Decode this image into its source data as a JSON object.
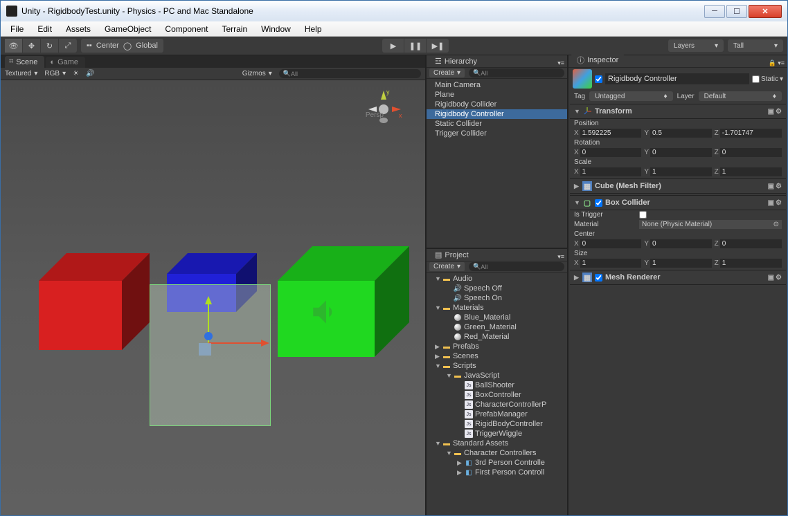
{
  "window": {
    "title": "Unity - RigidbodyTest.unity - Physics - PC and Mac Standalone"
  },
  "menu": [
    "File",
    "Edit",
    "Assets",
    "GameObject",
    "Component",
    "Terrain",
    "Window",
    "Help"
  ],
  "toolbar": {
    "center": "Center",
    "global": "Global",
    "layers": "Layers",
    "layout": "Tall"
  },
  "sceneTab": "Scene",
  "gameTab": "Game",
  "sceneBar": {
    "render": "Textured",
    "color": "RGB",
    "gizmos": "Gizmos",
    "search": "All"
  },
  "persp": "Persp",
  "hierarchy": {
    "title": "Hierarchy",
    "create": "Create",
    "search": "All",
    "items": [
      "Main Camera",
      "Plane",
      "Rigidbody Collider",
      "Rigidbody Controller",
      "Static Collider",
      "Trigger Collider"
    ]
  },
  "project": {
    "title": "Project",
    "create": "Create",
    "search": "All",
    "tree": [
      {
        "n": "Audio",
        "t": "folder",
        "d": 0,
        "open": true
      },
      {
        "n": "Speech Off",
        "t": "audio",
        "d": 1
      },
      {
        "n": "Speech On",
        "t": "audio",
        "d": 1
      },
      {
        "n": "Materials",
        "t": "folder",
        "d": 0,
        "open": true
      },
      {
        "n": "Blue_Material",
        "t": "mat",
        "d": 1
      },
      {
        "n": "Green_Material",
        "t": "mat",
        "d": 1
      },
      {
        "n": "Red_Material",
        "t": "mat",
        "d": 1
      },
      {
        "n": "Prefabs",
        "t": "folder",
        "d": 0,
        "open": false
      },
      {
        "n": "Scenes",
        "t": "folder",
        "d": 0,
        "open": false
      },
      {
        "n": "Scripts",
        "t": "folder",
        "d": 0,
        "open": true
      },
      {
        "n": "JavaScript",
        "t": "folder",
        "d": 1,
        "open": true
      },
      {
        "n": "BallShooter",
        "t": "script",
        "d": 2
      },
      {
        "n": "BoxController",
        "t": "script",
        "d": 2
      },
      {
        "n": "CharacterControllerP",
        "t": "script",
        "d": 2
      },
      {
        "n": "PrefabManager",
        "t": "script",
        "d": 2
      },
      {
        "n": "RigidBodyController",
        "t": "script",
        "d": 2
      },
      {
        "n": "TriggerWiggle",
        "t": "script",
        "d": 2
      },
      {
        "n": "Standard Assets",
        "t": "folder",
        "d": 0,
        "open": true
      },
      {
        "n": "Character Controllers",
        "t": "folder",
        "d": 1,
        "open": true
      },
      {
        "n": "3rd Person Controlle",
        "t": "prefab",
        "d": 2,
        "fold": true
      },
      {
        "n": "First Person Controll",
        "t": "prefab",
        "d": 2,
        "fold": true
      }
    ]
  },
  "inspector": {
    "title": "Inspector",
    "go": {
      "name": "Rigidbody Controller",
      "static": "Static",
      "tag": "Tag",
      "tagv": "Untagged",
      "layer": "Layer",
      "layerv": "Default"
    },
    "transform": {
      "title": "Transform",
      "pos": "Position",
      "rot": "Rotation",
      "scl": "Scale",
      "p": {
        "x": "1.592225",
        "y": "0.5",
        "z": "-1.701747"
      },
      "r": {
        "x": "0",
        "y": "0",
        "z": "0"
      },
      "s": {
        "x": "1",
        "y": "1",
        "z": "1"
      }
    },
    "mesh": {
      "title": "Cube (Mesh Filter)"
    },
    "box": {
      "title": "Box Collider",
      "trigger": "Is Trigger",
      "material": "Material",
      "matv": "None (Physic Material)",
      "center": "Center",
      "size": "Size",
      "c": {
        "x": "0",
        "y": "0",
        "z": "0"
      },
      "sz": {
        "x": "1",
        "y": "1",
        "z": "1"
      }
    },
    "renderer": {
      "title": "Mesh Renderer"
    }
  }
}
